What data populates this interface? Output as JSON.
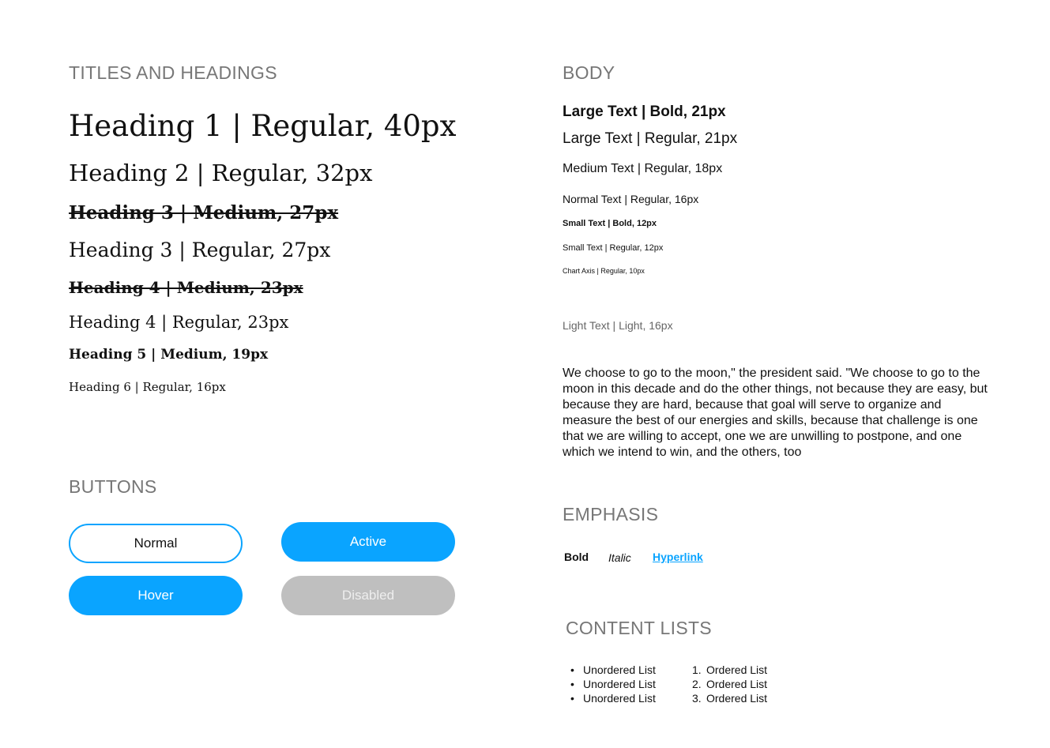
{
  "sections": {
    "titles": "TITLES AND HEADINGS",
    "body": "BODY",
    "buttons": "BUTTONS",
    "emphasis": "EMPHASIS",
    "lists": "CONTENT LISTS"
  },
  "headings": {
    "h1": "Heading 1 | Regular, 40px",
    "h2": "Heading 2 | Regular, 32px",
    "h3_medium": "Heading 3 | Medium, 27px",
    "h3_regular": "Heading 3 | Regular, 27px",
    "h4_medium": "Heading 4 | Medium, 23px",
    "h4_regular": "Heading 4 | Regular, 23px",
    "h5": "Heading 5 | Medium, 19px",
    "h6": "Heading 6 | Regular, 16px"
  },
  "buttons": {
    "normal": "Normal",
    "active": "Active",
    "hover": "Hover",
    "disabled": "Disabled",
    "accent_color": "#0aa4ff",
    "disabled_color": "#bfbfbf"
  },
  "body_text": {
    "large_bold": "Large Text | Bold, 21px",
    "large_regular": "Large Text | Regular, 21px",
    "medium": "Medium Text | Regular, 18px",
    "normal": "Normal Text | Regular, 16px",
    "small_bold": "Small Text | Bold, 12px",
    "small_regular": "Small Text | Regular, 12px",
    "chart_axis": "Chart Axis | Regular, 10px",
    "light": "Light Text | Light, 16px",
    "paragraph": "We choose to go to the moon,\" the president said. \"We choose to go to the moon in this decade and do the other things, not because they are easy, but because they are hard, because that goal will serve to organize and measure the best of our energies and skills, because that challenge is one that we are willing to accept, one we are unwilling to postpone, and one which we intend to win, and the others, too"
  },
  "emphasis": {
    "bold": "Bold",
    "italic": "Italic",
    "hyperlink": "Hyperlink"
  },
  "lists": {
    "unordered": [
      "Unordered List",
      "Unordered List",
      "Unordered List"
    ],
    "ordered": [
      {
        "num": "1.",
        "text": "Ordered List"
      },
      {
        "num": "2.",
        "text": "Ordered List"
      },
      {
        "num": "3.",
        "text": "Ordered List"
      }
    ]
  }
}
